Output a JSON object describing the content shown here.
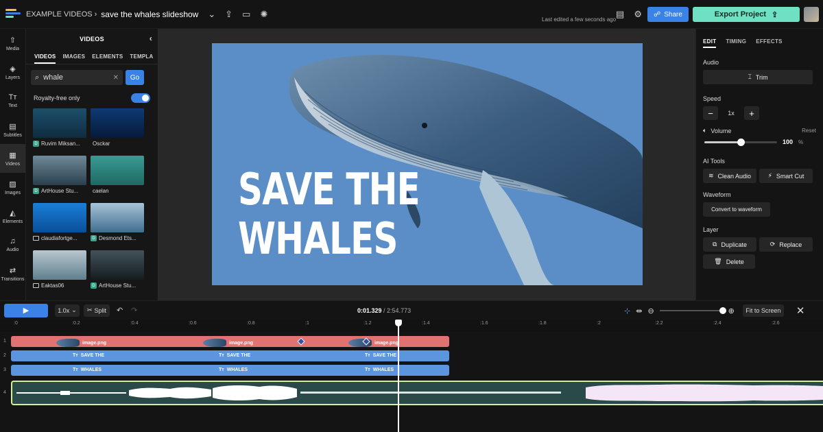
{
  "header": {
    "logo_colors": [
      "#f2c14e",
      "#3a82e6",
      "#6fe0c2",
      "#e07272"
    ],
    "folder": "EXAMPLE VIDEOS",
    "separator": "›",
    "project_title": "save the whales slideshow",
    "last_edited": "Last edited a few seconds ago",
    "share_label": "Share",
    "export_label": "Export Project"
  },
  "leftnav": {
    "items": [
      {
        "label": "Media",
        "icon": "upload-icon"
      },
      {
        "label": "Layers",
        "icon": "layers-icon"
      },
      {
        "label": "Text",
        "icon": "text-icon"
      },
      {
        "label": "Subtitles",
        "icon": "subtitles-icon"
      },
      {
        "label": "Videos",
        "icon": "film-icon"
      },
      {
        "label": "Images",
        "icon": "image-icon"
      },
      {
        "label": "Elements",
        "icon": "shapes-icon"
      },
      {
        "label": "Audio",
        "icon": "music-icon"
      },
      {
        "label": "Transitions",
        "icon": "transition-icon"
      }
    ]
  },
  "media_panel": {
    "title": "VIDEOS",
    "tabs": [
      "VIDEOS",
      "IMAGES",
      "ELEMENTS",
      "TEMPLA"
    ],
    "search_value": "whale",
    "go_label": "Go",
    "royalty_label": "Royalty-free only",
    "royalty_on": true,
    "results": [
      {
        "label": "Ruvim Miksan...",
        "badge": "D",
        "colors": [
          "#1d4f6b",
          "#0f2c40"
        ]
      },
      {
        "label": "Osckar",
        "badge": "",
        "colors": [
          "#0e3a73",
          "#061a3a"
        ]
      },
      {
        "label": "ArtHouse Stu...",
        "badge": "D",
        "colors": [
          "#6f8a98",
          "#2a3f4c"
        ]
      },
      {
        "label": "caelan",
        "badge": "",
        "colors": [
          "#3a9b94",
          "#1e6962"
        ]
      },
      {
        "label": "claudiafortge...",
        "badge": "V",
        "colors": [
          "#1a7fd6",
          "#0a4f9a"
        ]
      },
      {
        "label": "Desmond Ets...",
        "badge": "D",
        "colors": [
          "#a9c3d8",
          "#3e6d8d"
        ]
      },
      {
        "label": "Eaktas06",
        "badge": "V",
        "colors": [
          "#b7c7cf",
          "#5f7f8e"
        ]
      },
      {
        "label": "ArtHouse Stu...",
        "badge": "D",
        "colors": [
          "#43525a",
          "#151c20"
        ]
      }
    ]
  },
  "canvas": {
    "bg_color": "#5b8dc6",
    "line1": "SAVE THE",
    "line2": "WHALES"
  },
  "right_panel": {
    "tabs": [
      "EDIT",
      "TIMING",
      "EFFECTS"
    ],
    "audio_label": "Audio",
    "trim_label": "Trim",
    "speed_label": "Speed",
    "speed_value": "1x",
    "volume_label": "Volume",
    "reset_label": "Reset",
    "volume_value": "100",
    "volume_unit": "%",
    "volume_level": 0.5,
    "ai_tools_label": "AI Tools",
    "clean_audio_label": "Clean Audio",
    "smart_cut_label": "Smart Cut",
    "waveform_label": "Waveform",
    "convert_label": "Convert to waveform",
    "layer_label": "Layer",
    "duplicate_label": "Duplicate",
    "replace_label": "Replace",
    "delete_label": "Delete"
  },
  "timeline": {
    "speed": "1.0x",
    "split_label": "Split",
    "current_time": "0:01.329",
    "total_time": "/ 2:54.773",
    "fit_label": "Fit to Screen",
    "ticks": [
      ":0",
      ":0.2",
      ":0.4",
      ":0.6",
      ":0.8",
      ":1",
      ":1.2",
      ":1.4",
      ":1.6",
      ":1.8",
      ":2",
      ":2.2",
      ":2.4",
      ":2.6"
    ],
    "track_numbers": [
      "1",
      "2",
      "3",
      "4"
    ],
    "image_clip_label": "image.png",
    "text_clip_1": "SAVE THE",
    "text_clip_2": "WHALES",
    "text_prefix": "Tт"
  }
}
